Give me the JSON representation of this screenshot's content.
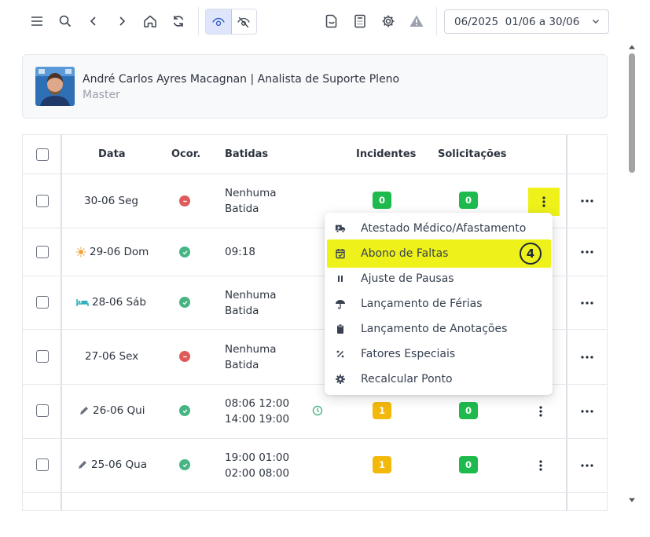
{
  "toolbar": {
    "icons": [
      "menu-icon",
      "search-icon",
      "chevron-left-icon",
      "chevron-right-icon",
      "home-icon",
      "refresh-icon",
      "eye-icon",
      "eye-off-icon",
      "document-icon",
      "calculator-icon",
      "gear-icon",
      "warning-icon"
    ],
    "period": "06/2025  01/06 a 30/06"
  },
  "profile": {
    "name": "André Carlos Ayres Macagnan | Analista de Suporte Pleno",
    "role": "Master"
  },
  "table": {
    "headers": {
      "date": "Data",
      "occurrence": "Ocor.",
      "punches": "Batidas",
      "incidents": "Incidentes",
      "requests": "Solicitações"
    },
    "rows": [
      {
        "date": "30-06 Seg",
        "icon": "",
        "status": "error",
        "punch1": "Nenhuma",
        "punch2": "Batida",
        "incidents": "0",
        "incidents_color": "green",
        "requests": "0"
      },
      {
        "date": "29-06 Dom",
        "icon": "sun-icon",
        "status": "ok",
        "punch1": "09:18",
        "punch2": ""
      },
      {
        "date": "28-06 Sáb",
        "icon": "bed-icon",
        "status": "ok",
        "punch1": "Nenhuma",
        "punch2": "Batida"
      },
      {
        "date": "27-06 Sex",
        "icon": "",
        "status": "error",
        "punch1": "Nenhuma",
        "punch2": "Batida"
      },
      {
        "date": "26-06 Qui",
        "icon": "pencil-icon",
        "status": "ok",
        "punch1": "08:06 12:00",
        "punch2": "14:00 19:00",
        "incidents": "1",
        "incidents_color": "yellow",
        "requests": "0"
      },
      {
        "date": "25-06 Qua",
        "icon": "pencil-icon",
        "status": "ok",
        "punch1": "19:00 01:00",
        "punch2": "02:00 08:00",
        "incidents": "1",
        "incidents_color": "yellow",
        "requests": "0"
      }
    ]
  },
  "menu": {
    "items": [
      {
        "label": "Atestado Médico/Afastamento",
        "icon": "truck-medical-icon"
      },
      {
        "label": "Abono de Faltas",
        "icon": "calendar-check-icon"
      },
      {
        "label": "Ajuste de Pausas",
        "icon": "pause-icon"
      },
      {
        "label": "Lançamento de Férias",
        "icon": "umbrella-icon"
      },
      {
        "label": "Lançamento de Anotações",
        "icon": "clipboard-icon"
      },
      {
        "label": "Fatores Especiais",
        "icon": "percent-icon"
      },
      {
        "label": "Recalcular Ponto",
        "icon": "gear-icon"
      }
    ],
    "step_badge": "4"
  },
  "colors": {
    "highlight": "#eef21a",
    "badge_green": "#1fba4e",
    "badge_yellow": "#f2b90b",
    "status_error": "#e05a5a",
    "status_ok": "#46b583",
    "accent": "#3b62c9"
  }
}
